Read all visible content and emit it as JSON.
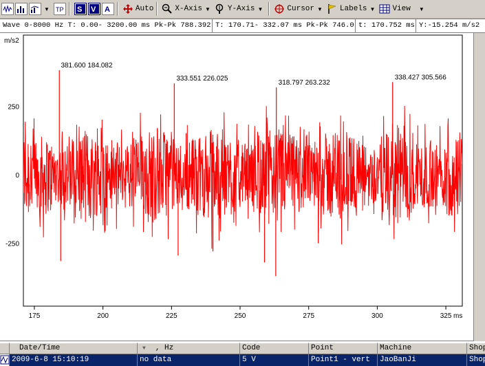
{
  "toolbar": {
    "auto_label": "Auto",
    "xaxis_label": "X-Axis",
    "yaxis_label": "Y-Axis",
    "cursor_label": "Cursor",
    "labels_label": "Labels",
    "view_label": "View"
  },
  "infobar": {
    "cell1": "Wave 0-8000 Hz  T: 0.00- 3200.00 ms  Pk-Pk 788.392",
    "cell2": "T: 170.71- 332.07 ms  Pk-Pk 746.0",
    "cell3": "t: 170.752 ms",
    "cell4": "Y:-15.254 m/s2"
  },
  "chart_data": {
    "type": "line",
    "ylabel": "m/s2",
    "xlabel": "ms",
    "xlim": [
      171,
      331
    ],
    "ylim": [
      -480,
      510
    ],
    "xticks": [
      175,
      200,
      225,
      250,
      275,
      300,
      325
    ],
    "yticks": [
      250,
      0,
      -250
    ],
    "color": "#ff0000",
    "grid": false,
    "peak_labels": [
      {
        "x": 183.9,
        "y": 381.6,
        "text": "381.600   184.082"
      },
      {
        "x": 226.0,
        "y": 333.551,
        "text": "333.551   226.025"
      },
      {
        "x": 263.2,
        "y": 318.797,
        "text": "318.797   263.232"
      },
      {
        "x": 305.6,
        "y": 338.427,
        "text": "338.427   305.566"
      }
    ],
    "peaks": [
      {
        "x": 184.1,
        "y": 381.6
      },
      {
        "x": 226.0,
        "y": 333.551
      },
      {
        "x": 263.2,
        "y": 318.797
      },
      {
        "x": 305.6,
        "y": 338.427
      },
      {
        "x": 184.6,
        "y": -315
      },
      {
        "x": 263.0,
        "y": -370
      },
      {
        "x": 227.4,
        "y": -295
      },
      {
        "x": 240.1,
        "y": -280
      },
      {
        "x": 258.9,
        "y": -320
      },
      {
        "x": 278.5,
        "y": -250
      }
    ]
  },
  "grid": {
    "headers": [
      "Date/Time",
      ", Hz",
      "Code",
      "Point",
      "Machine",
      "Shop"
    ],
    "row": [
      "2009-6-8 15:10:19",
      "no data",
      "5 V",
      "Point1 - vert",
      "JaoBanJi",
      "Shop"
    ]
  }
}
